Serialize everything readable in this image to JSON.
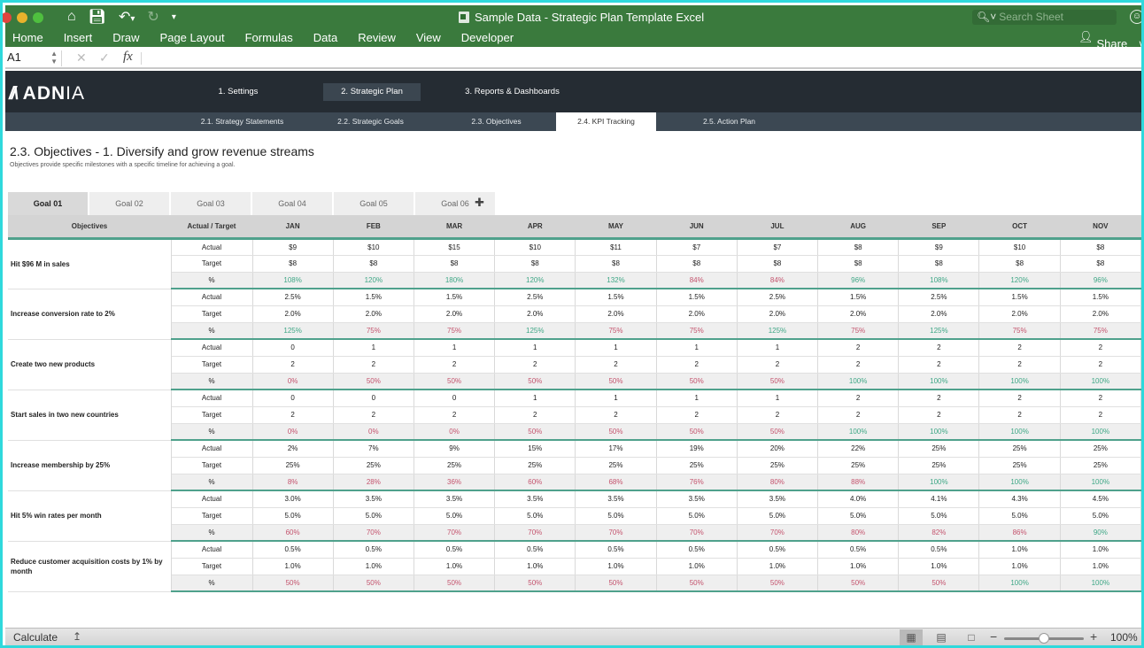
{
  "window": {
    "title": "Sample Data - Strategic Plan Template Excel",
    "search_placeholder": "Search Sheet",
    "share_label": "Share"
  },
  "quick_access": {
    "home_icon": "home-icon",
    "save_icon": "save-icon",
    "undo_icon": "undo-icon",
    "redo_icon": "redo-icon",
    "customize_icon": "customize-icon"
  },
  "ribbon_tabs": [
    "Home",
    "Insert",
    "Draw",
    "Page Layout",
    "Formulas",
    "Data",
    "Review",
    "View",
    "Developer"
  ],
  "formula_bar": {
    "name_box": "A1",
    "fx_label": "fx",
    "value": ""
  },
  "app_nav": {
    "logo_text": "ADN",
    "logo_text_light": "IA",
    "main_tabs": [
      {
        "label": "1. Settings",
        "active": false
      },
      {
        "label": "2. Strategic Plan",
        "active": true
      },
      {
        "label": "3. Reports & Dashboards",
        "active": false
      }
    ],
    "sub_tabs": [
      {
        "label": "2.1. Strategy Statements",
        "active": false
      },
      {
        "label": "2.2. Strategic Goals",
        "active": false
      },
      {
        "label": "2.3. Objectives",
        "active": false
      },
      {
        "label": "2.4. KPI Tracking",
        "active": true
      },
      {
        "label": "2.5. Action Plan",
        "active": false
      }
    ]
  },
  "page": {
    "title": "2.3. Objectives - 1. Diversify and grow revenue streams",
    "subtitle": "Objectives provide specific milestones with a specific timeline for achieving a goal."
  },
  "goal_tabs": [
    {
      "label": "Goal 01",
      "active": true
    },
    {
      "label": "Goal 02",
      "active": false
    },
    {
      "label": "Goal 03",
      "active": false
    },
    {
      "label": "Goal 04",
      "active": false
    },
    {
      "label": "Goal 05",
      "active": false
    },
    {
      "label": "Goal 06",
      "active": false
    }
  ],
  "table": {
    "headers": {
      "objectives": "Objectives",
      "actual_target": "Actual / Target",
      "months": [
        "JAN",
        "FEB",
        "MAR",
        "APR",
        "MAY",
        "JUN",
        "JUL",
        "AUG",
        "SEP",
        "OCT",
        "NOV"
      ]
    },
    "row_labels": {
      "actual": "Actual",
      "target": "Target",
      "pct": "%"
    },
    "colors": {
      "good": "#3fa786",
      "bad": "#c4536d",
      "accent_line": "#4fa18c"
    },
    "objectives": [
      {
        "name": "Hit $96 M in sales",
        "actual": [
          "$9",
          "$10",
          "$15",
          "$10",
          "$11",
          "$7",
          "$7",
          "$8",
          "$9",
          "$10",
          "$8"
        ],
        "target": [
          "$8",
          "$8",
          "$8",
          "$8",
          "$8",
          "$8",
          "$8",
          "$8",
          "$8",
          "$8",
          "$8"
        ],
        "pct": [
          "108%",
          "120%",
          "180%",
          "120%",
          "132%",
          "84%",
          "84%",
          "96%",
          "108%",
          "120%",
          "96%"
        ],
        "status": [
          "good",
          "good",
          "good",
          "good",
          "good",
          "bad",
          "bad",
          "good",
          "good",
          "good",
          "good"
        ]
      },
      {
        "name": "Increase conversion rate to 2%",
        "actual": [
          "2.5%",
          "1.5%",
          "1.5%",
          "2.5%",
          "1.5%",
          "1.5%",
          "2.5%",
          "1.5%",
          "2.5%",
          "1.5%",
          "1.5%"
        ],
        "target": [
          "2.0%",
          "2.0%",
          "2.0%",
          "2.0%",
          "2.0%",
          "2.0%",
          "2.0%",
          "2.0%",
          "2.0%",
          "2.0%",
          "2.0%"
        ],
        "pct": [
          "125%",
          "75%",
          "75%",
          "125%",
          "75%",
          "75%",
          "125%",
          "75%",
          "125%",
          "75%",
          "75%"
        ],
        "status": [
          "good",
          "bad",
          "bad",
          "good",
          "bad",
          "bad",
          "good",
          "bad",
          "good",
          "bad",
          "bad"
        ]
      },
      {
        "name": "Create two new products",
        "actual": [
          "0",
          "1",
          "1",
          "1",
          "1",
          "1",
          "1",
          "2",
          "2",
          "2",
          "2"
        ],
        "target": [
          "2",
          "2",
          "2",
          "2",
          "2",
          "2",
          "2",
          "2",
          "2",
          "2",
          "2"
        ],
        "pct": [
          "0%",
          "50%",
          "50%",
          "50%",
          "50%",
          "50%",
          "50%",
          "100%",
          "100%",
          "100%",
          "100%"
        ],
        "status": [
          "bad",
          "bad",
          "bad",
          "bad",
          "bad",
          "bad",
          "bad",
          "good",
          "good",
          "good",
          "good"
        ]
      },
      {
        "name": "Start sales in two new countries",
        "actual": [
          "0",
          "0",
          "0",
          "1",
          "1",
          "1",
          "1",
          "2",
          "2",
          "2",
          "2"
        ],
        "target": [
          "2",
          "2",
          "2",
          "2",
          "2",
          "2",
          "2",
          "2",
          "2",
          "2",
          "2"
        ],
        "pct": [
          "0%",
          "0%",
          "0%",
          "50%",
          "50%",
          "50%",
          "50%",
          "100%",
          "100%",
          "100%",
          "100%"
        ],
        "status": [
          "bad",
          "bad",
          "bad",
          "bad",
          "bad",
          "bad",
          "bad",
          "good",
          "good",
          "good",
          "good"
        ]
      },
      {
        "name": "Increase membership by 25%",
        "actual": [
          "2%",
          "7%",
          "9%",
          "15%",
          "17%",
          "19%",
          "20%",
          "22%",
          "25%",
          "25%",
          "25%"
        ],
        "target": [
          "25%",
          "25%",
          "25%",
          "25%",
          "25%",
          "25%",
          "25%",
          "25%",
          "25%",
          "25%",
          "25%"
        ],
        "pct": [
          "8%",
          "28%",
          "36%",
          "60%",
          "68%",
          "76%",
          "80%",
          "88%",
          "100%",
          "100%",
          "100%"
        ],
        "status": [
          "bad",
          "bad",
          "bad",
          "bad",
          "bad",
          "bad",
          "bad",
          "bad",
          "good",
          "good",
          "good"
        ]
      },
      {
        "name": "Hit 5% win rates per month",
        "actual": [
          "3.0%",
          "3.5%",
          "3.5%",
          "3.5%",
          "3.5%",
          "3.5%",
          "3.5%",
          "4.0%",
          "4.1%",
          "4.3%",
          "4.5%"
        ],
        "target": [
          "5.0%",
          "5.0%",
          "5.0%",
          "5.0%",
          "5.0%",
          "5.0%",
          "5.0%",
          "5.0%",
          "5.0%",
          "5.0%",
          "5.0%"
        ],
        "pct": [
          "60%",
          "70%",
          "70%",
          "70%",
          "70%",
          "70%",
          "70%",
          "80%",
          "82%",
          "86%",
          "90%"
        ],
        "status": [
          "bad",
          "bad",
          "bad",
          "bad",
          "bad",
          "bad",
          "bad",
          "bad",
          "bad",
          "bad",
          "good"
        ]
      },
      {
        "name": "Reduce customer acquisition costs by 1% by month",
        "actual": [
          "0.5%",
          "0.5%",
          "0.5%",
          "0.5%",
          "0.5%",
          "0.5%",
          "0.5%",
          "0.5%",
          "0.5%",
          "1.0%",
          "1.0%"
        ],
        "target": [
          "1.0%",
          "1.0%",
          "1.0%",
          "1.0%",
          "1.0%",
          "1.0%",
          "1.0%",
          "1.0%",
          "1.0%",
          "1.0%",
          "1.0%"
        ],
        "pct": [
          "50%",
          "50%",
          "50%",
          "50%",
          "50%",
          "50%",
          "50%",
          "50%",
          "50%",
          "100%",
          "100%"
        ],
        "status": [
          "bad",
          "bad",
          "bad",
          "bad",
          "bad",
          "bad",
          "bad",
          "bad",
          "bad",
          "good",
          "good"
        ]
      }
    ]
  },
  "status_bar": {
    "calculate_label": "Calculate",
    "zoom_level": "100%",
    "zoom_fraction": 0.5,
    "active_view": "normal"
  }
}
